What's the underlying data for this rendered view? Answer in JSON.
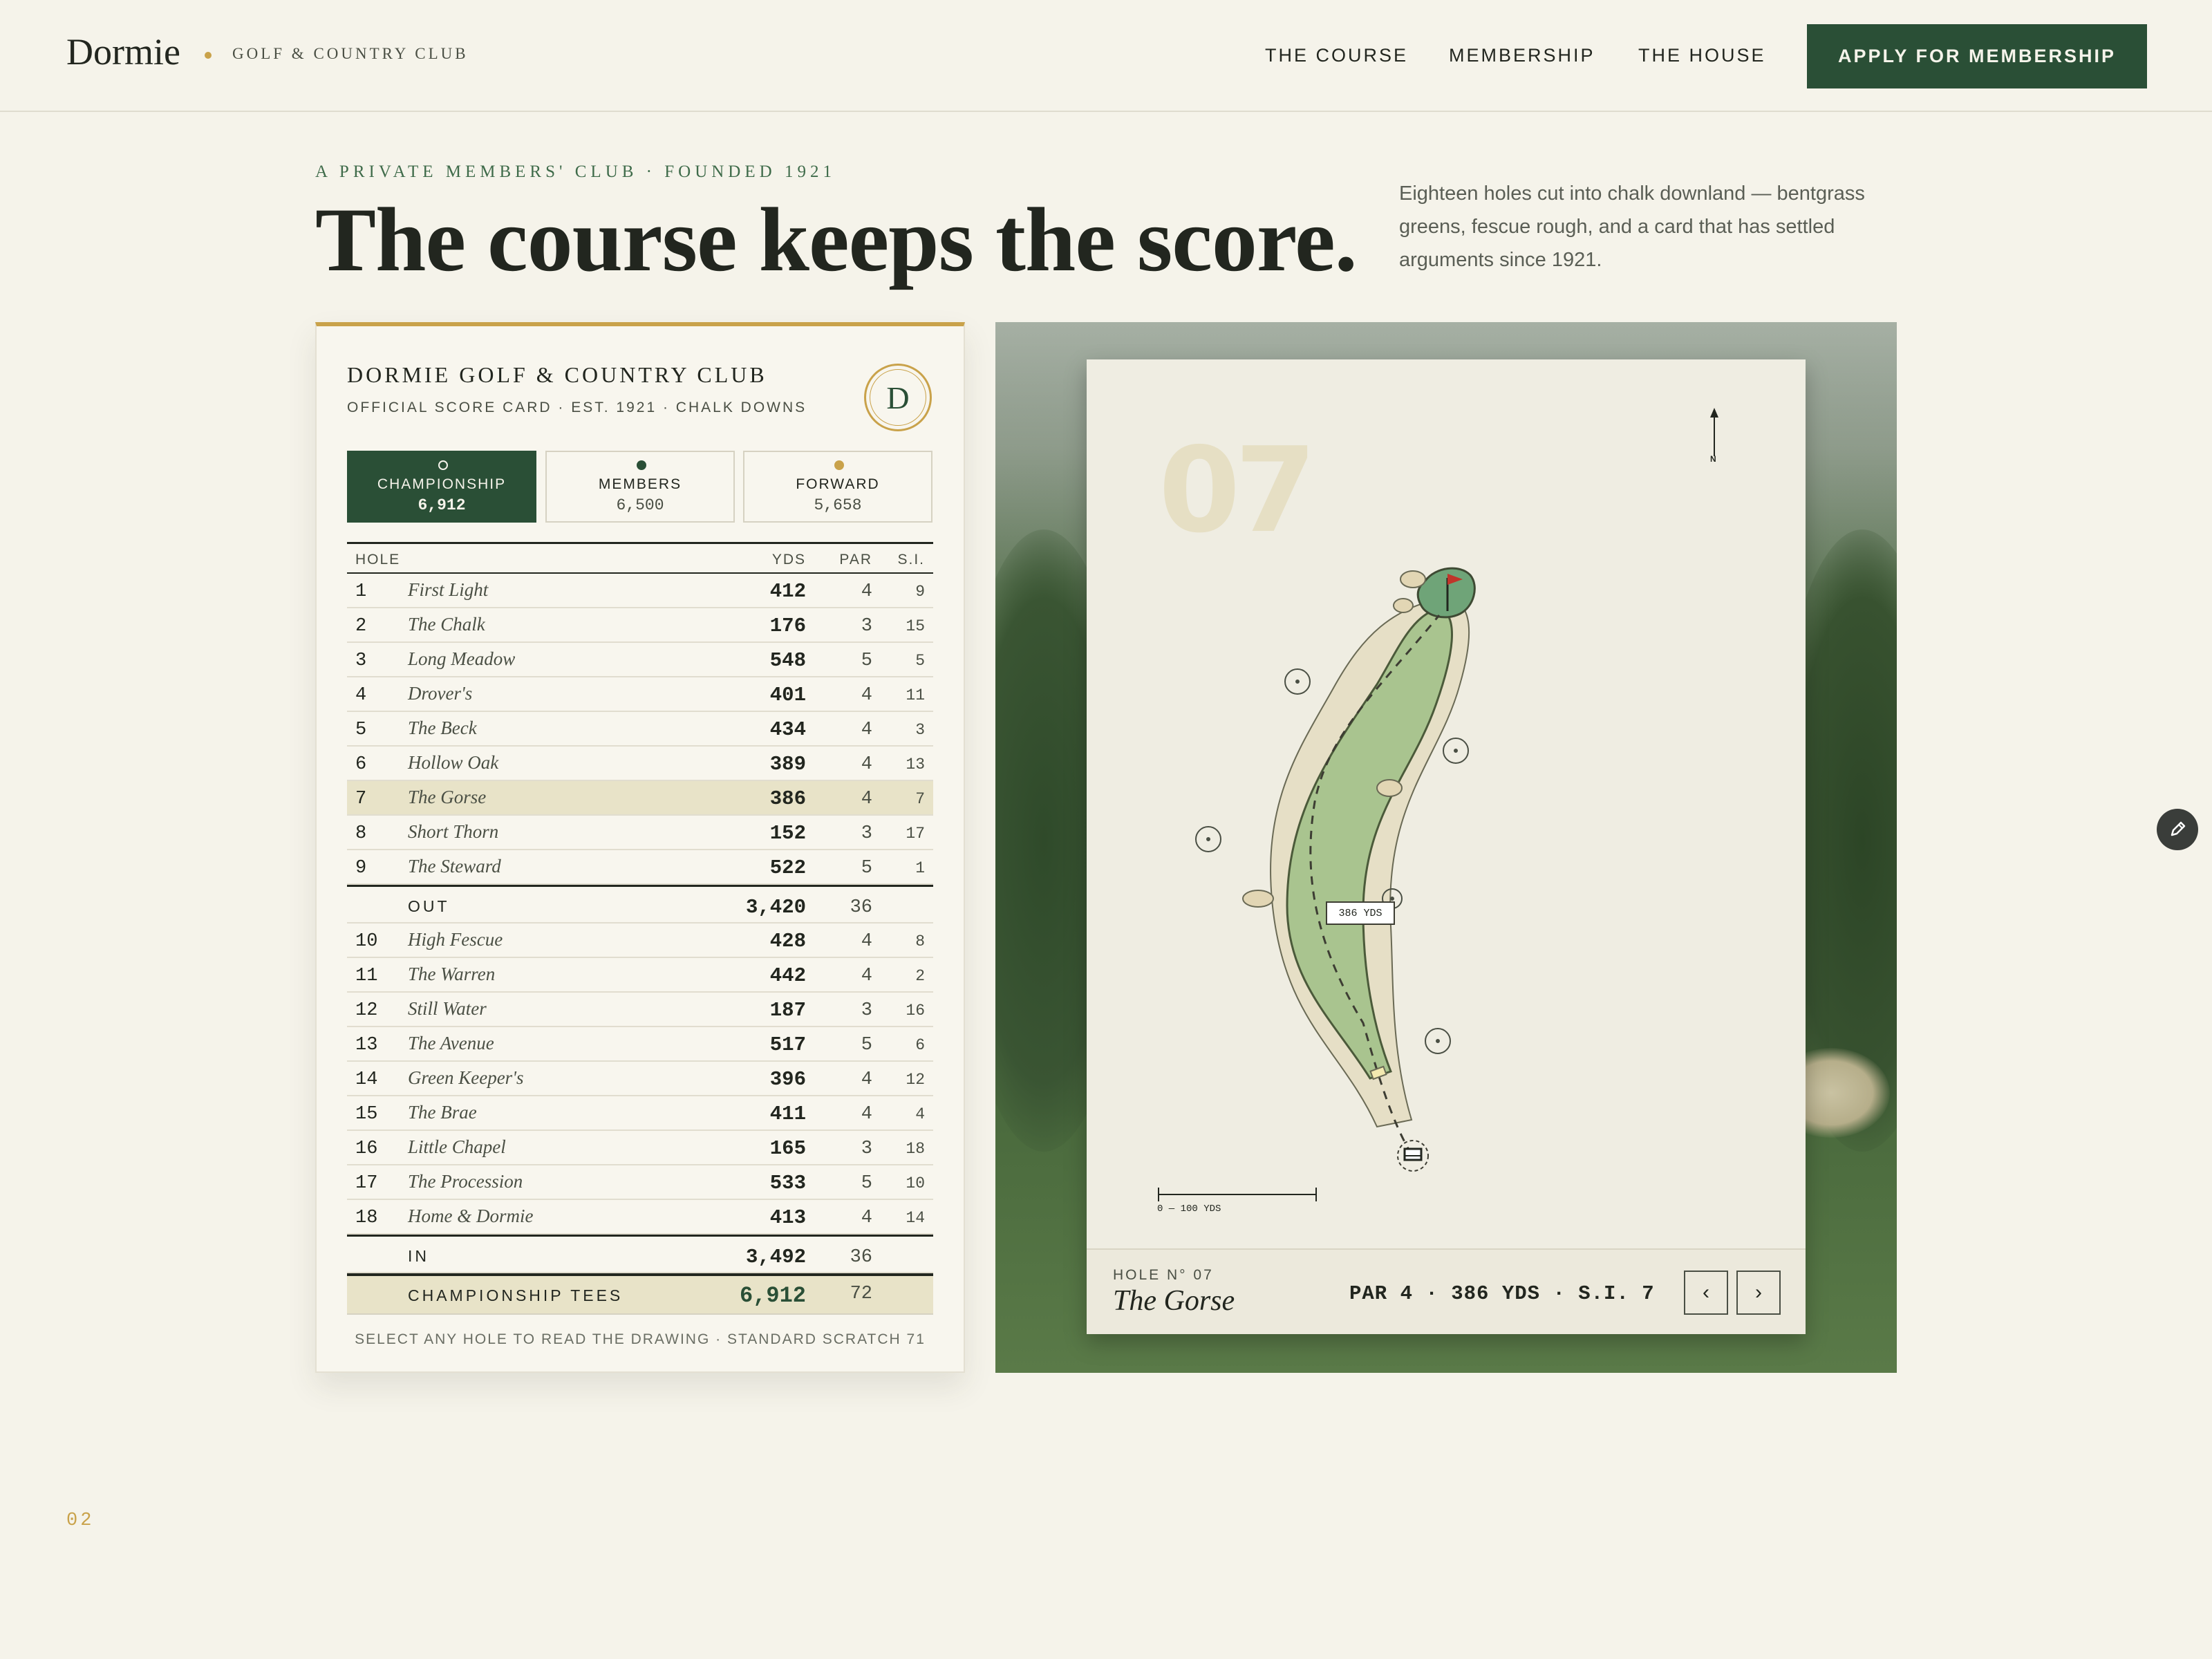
{
  "header": {
    "logo": "Dormie",
    "subtitle": "GOLF & COUNTRY CLUB",
    "nav": [
      "THE COURSE",
      "MEMBERSHIP",
      "THE HOUSE"
    ],
    "cta": "APPLY FOR MEMBERSHIP"
  },
  "hero": {
    "eyebrow": "A PRIVATE MEMBERS' CLUB · FOUNDED 1921",
    "headline": "The course keeps the score.",
    "intro": "Eighteen holes cut into chalk downland — bentgrass greens, fescue rough, and a card that has settled arguments since 1921."
  },
  "scorecard": {
    "title": "DORMIE GOLF & COUNTRY CLUB",
    "subtitle": "OFFICIAL SCORE CARD · EST. 1921 · CHALK DOWNS",
    "crest_letter": "D",
    "tees": [
      {
        "name": "CHAMPIONSHIP",
        "yards": "6,912",
        "color": "#2a4f36",
        "active": true
      },
      {
        "name": "MEMBERS",
        "yards": "6,500",
        "color": "#2a4f36",
        "active": false
      },
      {
        "name": "FORWARD",
        "yards": "5,658",
        "color": "#c9a24a",
        "active": false
      }
    ],
    "columns": {
      "hole": "HOLE",
      "yds": "YDS",
      "par": "PAR",
      "si": "S.I."
    },
    "front_nine": [
      {
        "num": "1",
        "name": "First Light",
        "yds": "412",
        "par": "4",
        "si": "9"
      },
      {
        "num": "2",
        "name": "The Chalk",
        "yds": "176",
        "par": "3",
        "si": "15"
      },
      {
        "num": "3",
        "name": "Long Meadow",
        "yds": "548",
        "par": "5",
        "si": "5"
      },
      {
        "num": "4",
        "name": "Drover's",
        "yds": "401",
        "par": "4",
        "si": "11"
      },
      {
        "num": "5",
        "name": "The Beck",
        "yds": "434",
        "par": "4",
        "si": "3"
      },
      {
        "num": "6",
        "name": "Hollow Oak",
        "yds": "389",
        "par": "4",
        "si": "13"
      },
      {
        "num": "7",
        "name": "The Gorse",
        "yds": "386",
        "par": "4",
        "si": "7",
        "selected": true
      },
      {
        "num": "8",
        "name": "Short Thorn",
        "yds": "152",
        "par": "3",
        "si": "17"
      },
      {
        "num": "9",
        "name": "The Steward",
        "yds": "522",
        "par": "5",
        "si": "1"
      }
    ],
    "out": {
      "label": "OUT",
      "yds": "3,420",
      "par": "36"
    },
    "back_nine": [
      {
        "num": "10",
        "name": "High Fescue",
        "yds": "428",
        "par": "4",
        "si": "8"
      },
      {
        "num": "11",
        "name": "The Warren",
        "yds": "442",
        "par": "4",
        "si": "2"
      },
      {
        "num": "12",
        "name": "Still Water",
        "yds": "187",
        "par": "3",
        "si": "16"
      },
      {
        "num": "13",
        "name": "The Avenue",
        "yds": "517",
        "par": "5",
        "si": "6"
      },
      {
        "num": "14",
        "name": "Green Keeper's",
        "yds": "396",
        "par": "4",
        "si": "12"
      },
      {
        "num": "15",
        "name": "The Brae",
        "yds": "411",
        "par": "4",
        "si": "4"
      },
      {
        "num": "16",
        "name": "Little Chapel",
        "yds": "165",
        "par": "3",
        "si": "18"
      },
      {
        "num": "17",
        "name": "The Procession",
        "yds": "533",
        "par": "5",
        "si": "10"
      },
      {
        "num": "18",
        "name": "Home & Dormie",
        "yds": "413",
        "par": "4",
        "si": "14"
      }
    ],
    "in": {
      "label": "IN",
      "yds": "3,492",
      "par": "36"
    },
    "total": {
      "label": "CHAMPIONSHIP TEES",
      "yds": "6,912",
      "par": "72"
    },
    "footer": "SELECT ANY HOLE TO READ THE DRAWING · STANDARD SCRATCH 71"
  },
  "hole_map": {
    "big_number": "07",
    "north": "N",
    "yardage_tag": "386 YDS",
    "scale": "0 — 100 YDS",
    "hole_label": "HOLE N° 07",
    "hole_name": "The Gorse",
    "stats": "PAR 4 · 386 YDS · S.I. 7",
    "prev": "‹",
    "next": "›"
  },
  "page_number": "02",
  "colors": {
    "accent": "#2a4f36",
    "gold": "#c9a24a",
    "paper": "#f5f3ea"
  }
}
